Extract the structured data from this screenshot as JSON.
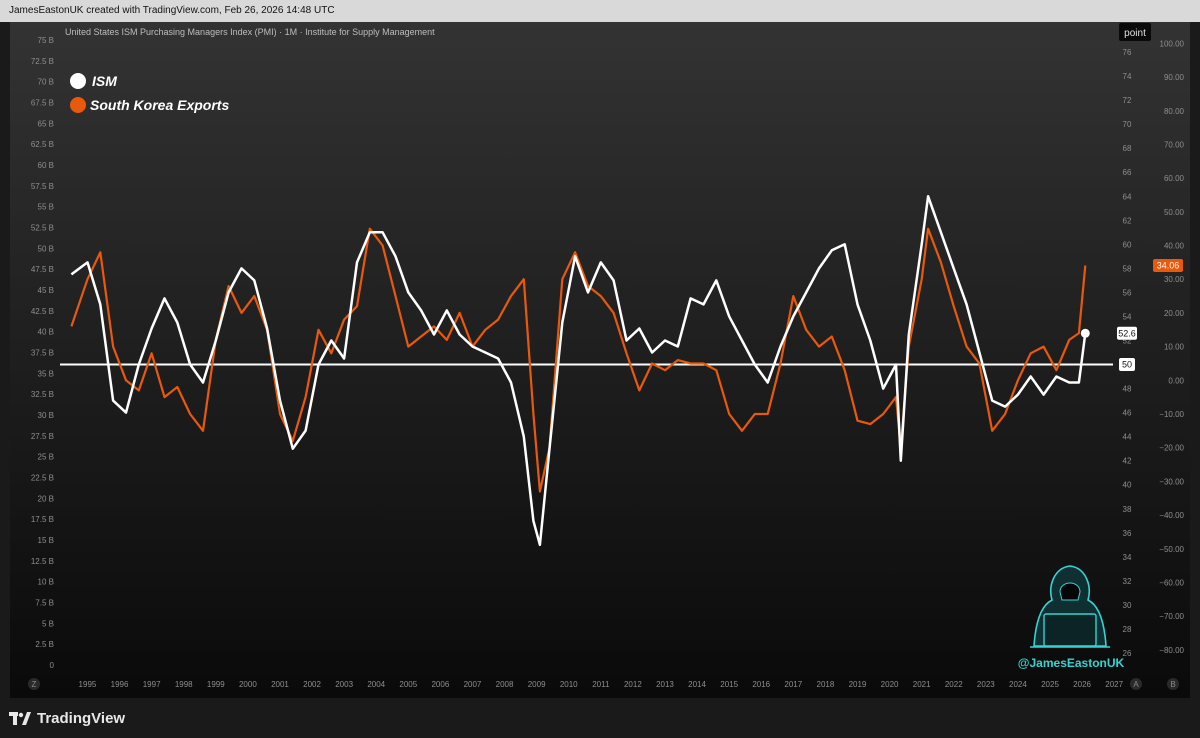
{
  "header": {
    "attribution": "JamesEastonUK created with TradingView.com, Feb 26, 2026 14:48 UTC"
  },
  "chart_title": "United States ISM Purchasing Managers Index (PMI) · 1M · Institute for Supply Management",
  "legend": {
    "items": [
      {
        "label": "ISM",
        "color": "#ffffff"
      },
      {
        "label": "South Korea Exports",
        "color": "#e8590c"
      }
    ]
  },
  "scale_button": "point",
  "watermark_handle": "@JamesEastonUK",
  "footer": {
    "brand": "TradingView"
  },
  "axis_corners": {
    "z": "Z",
    "a": "A",
    "b": "B"
  },
  "badges": {
    "ism_last": "52.6",
    "threshold": "50",
    "exports_last": "34.06"
  },
  "colors": {
    "ism": "#ffffff",
    "exports": "#e8590c",
    "background_top": "#333333",
    "background_bottom": "#0a0a0a"
  },
  "chart_data": {
    "type": "line",
    "x_range": [
      1994.3,
      2027.4
    ],
    "x_ticks": [
      "1995",
      "1996",
      "1997",
      "1998",
      "1999",
      "2000",
      "2001",
      "2002",
      "2003",
      "2004",
      "2005",
      "2006",
      "2007",
      "2008",
      "2009",
      "2010",
      "2011",
      "2012",
      "2013",
      "2014",
      "2015",
      "2016",
      "2017",
      "2018",
      "2019",
      "2020",
      "2021",
      "2022",
      "2023",
      "2024",
      "2025",
      "2026",
      "2027"
    ],
    "left_axis": {
      "unit": "B",
      "ylim": [
        0,
        75
      ],
      "ticks": [
        "75 B",
        "72.5 B",
        "70 B",
        "67.5 B",
        "65 B",
        "62.5 B",
        "60 B",
        "57.5 B",
        "55 B",
        "52.5 B",
        "50 B",
        "47.5 B",
        "45 B",
        "42.5 B",
        "40 B",
        "37.5 B",
        "35 B",
        "32.5 B",
        "30 B",
        "27.5 B",
        "25 B",
        "22.5 B",
        "20 B",
        "17.5 B",
        "15 B",
        "12.5 B",
        "10 B",
        "7.5 B",
        "5 B",
        "2.5 B",
        "0"
      ]
    },
    "mid_axis": {
      "ylim": [
        25,
        77
      ],
      "ticks": [
        "76",
        "74",
        "72",
        "70",
        "68",
        "66",
        "64",
        "62",
        "60",
        "58",
        "56",
        "54",
        "52",
        "50",
        "48",
        "46",
        "44",
        "42",
        "40",
        "38",
        "36",
        "34",
        "32",
        "30",
        "28",
        "26"
      ]
    },
    "right_axis": {
      "ylim": [
        -84.5,
        101
      ],
      "ticks": [
        "100.00",
        "90.00",
        "80.00",
        "70.00",
        "60.00",
        "50.00",
        "40.00",
        "30.00",
        "20.00",
        "10.00",
        "0.00",
        "−10.00",
        "−20.00",
        "−30.00",
        "−40.00",
        "−50.00",
        "−60.00",
        "−70.00",
        "−80.00"
      ]
    },
    "threshold": 50,
    "series": [
      {
        "name": "ISM",
        "axis": "mid",
        "color": "#ffffff",
        "x": [
          1994.5,
          1995.0,
          1995.4,
          1995.8,
          1996.2,
          1996.6,
          1997.0,
          1997.4,
          1997.8,
          1998.2,
          1998.6,
          1999.0,
          1999.4,
          1999.8,
          2000.2,
          2000.6,
          2001.0,
          2001.4,
          2001.8,
          2002.2,
          2002.6,
          2003.0,
          2003.4,
          2003.8,
          2004.2,
          2004.6,
          2005.0,
          2005.4,
          2005.8,
          2006.2,
          2006.6,
          2007.0,
          2007.4,
          2007.8,
          2008.2,
          2008.6,
          2008.9,
          2009.1,
          2009.4,
          2009.8,
          2010.2,
          2010.6,
          2011.0,
          2011.4,
          2011.8,
          2012.2,
          2012.6,
          2013.0,
          2013.4,
          2013.8,
          2014.2,
          2014.6,
          2015.0,
          2015.4,
          2015.8,
          2016.2,
          2016.6,
          2017.0,
          2017.4,
          2017.8,
          2018.2,
          2018.6,
          2019.0,
          2019.4,
          2019.8,
          2020.2,
          2020.35,
          2020.6,
          2021.0,
          2021.2,
          2021.6,
          2022.0,
          2022.4,
          2022.8,
          2023.2,
          2023.6,
          2024.0,
          2024.4,
          2024.8,
          2025.2,
          2025.6,
          2025.9,
          2026.1
        ],
        "y": [
          57.5,
          58.5,
          55,
          47,
          46,
          50,
          53,
          55.5,
          53.5,
          50,
          48.5,
          52,
          56,
          58,
          57,
          53,
          47,
          43,
          44.5,
          50,
          52,
          50.5,
          58.5,
          61,
          61,
          59,
          56,
          54.5,
          52.5,
          54.5,
          52.5,
          51.5,
          51,
          50.5,
          48.5,
          44,
          37,
          35,
          43,
          53.5,
          59,
          56,
          58.5,
          57,
          52,
          53,
          51,
          52,
          51.5,
          55.5,
          55,
          57,
          54,
          52,
          50,
          48.5,
          51.5,
          54,
          56,
          58,
          59.5,
          60,
          55,
          52,
          48,
          50,
          42,
          52.5,
          60,
          64,
          61,
          58,
          55,
          51,
          47,
          46.5,
          47.5,
          49,
          47.5,
          49,
          48.5,
          48.5,
          52.6
        ]
      },
      {
        "name": "South Korea Exports",
        "axis": "right",
        "color": "#e8590c",
        "x": [
          1994.5,
          1995.0,
          1995.4,
          1995.8,
          1996.2,
          1996.6,
          1997.0,
          1997.4,
          1997.8,
          1998.2,
          1998.6,
          1999.0,
          1999.4,
          1999.8,
          2000.2,
          2000.6,
          2001.0,
          2001.4,
          2001.8,
          2002.2,
          2002.6,
          2003.0,
          2003.4,
          2003.8,
          2004.2,
          2004.6,
          2005.0,
          2005.4,
          2005.8,
          2006.2,
          2006.6,
          2007.0,
          2007.4,
          2007.8,
          2008.2,
          2008.6,
          2008.9,
          2009.1,
          2009.4,
          2009.8,
          2010.2,
          2010.6,
          2011.0,
          2011.4,
          2011.8,
          2012.2,
          2012.6,
          2013.0,
          2013.4,
          2013.8,
          2014.2,
          2014.6,
          2015.0,
          2015.4,
          2015.8,
          2016.2,
          2016.6,
          2017.0,
          2017.4,
          2017.8,
          2018.2,
          2018.6,
          2019.0,
          2019.4,
          2019.8,
          2020.2,
          2020.35,
          2020.6,
          2021.0,
          2021.2,
          2021.6,
          2022.0,
          2022.4,
          2022.8,
          2023.2,
          2023.6,
          2024.0,
          2024.4,
          2024.8,
          2025.2,
          2025.6,
          2025.9,
          2026.1
        ],
        "y": [
          16,
          30,
          38,
          10,
          0,
          -3,
          8,
          -5,
          -2,
          -10,
          -15,
          12,
          28,
          20,
          25,
          15,
          -10,
          -18,
          -5,
          15,
          8,
          18,
          22,
          45,
          40,
          25,
          10,
          13,
          16,
          12,
          20,
          10,
          15,
          18,
          25,
          30,
          -10,
          -33,
          -20,
          30,
          38,
          28,
          25,
          20,
          8,
          -3,
          5,
          3,
          6,
          5,
          5,
          3,
          -10,
          -15,
          -10,
          -10,
          5,
          25,
          15,
          10,
          13,
          3,
          -12,
          -13,
          -10,
          -5,
          -20,
          10,
          30,
          45,
          35,
          22,
          10,
          5,
          -15,
          -10,
          0,
          8,
          10,
          3,
          12,
          14,
          34.06
        ]
      }
    ]
  }
}
